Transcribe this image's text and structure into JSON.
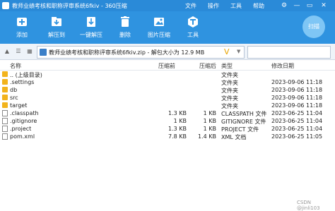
{
  "window": {
    "title": "教师业绩考核和职称评审系统6fkiv - 360压缩",
    "menus": [
      "文件",
      "操作",
      "工具",
      "帮助"
    ],
    "controls": [
      "⚙",
      "—",
      "▭",
      "✕"
    ]
  },
  "toolbar": {
    "items": [
      {
        "label": "添加",
        "icon": "add-icon"
      },
      {
        "label": "解压到",
        "icon": "extract-to-icon"
      },
      {
        "label": "一键解压",
        "icon": "one-click-extract-icon"
      },
      {
        "label": "删除",
        "icon": "delete-icon"
      },
      {
        "label": "图片压缩",
        "icon": "image-compress-icon"
      },
      {
        "label": "工具",
        "icon": "tools-icon"
      }
    ],
    "badge": "扫描"
  },
  "address": {
    "path": "教师业绩考核和职称评审系统6fkiv.zip - 解包大小为 12.9 MB"
  },
  "columns": {
    "name": "名称",
    "size": "压缩前",
    "compressed": "压缩后",
    "type": "类型",
    "modified": "修改日期"
  },
  "files": [
    {
      "name": ".. (上级目录)",
      "size": "",
      "compressed": "",
      "type": "文件夹",
      "modified": "",
      "kind": "folder"
    },
    {
      "name": ".settings",
      "size": "",
      "compressed": "",
      "type": "文件夹",
      "modified": "2023-09-06 11:18",
      "kind": "folder"
    },
    {
      "name": "db",
      "size": "",
      "compressed": "",
      "type": "文件夹",
      "modified": "2023-09-06 11:18",
      "kind": "folder"
    },
    {
      "name": "src",
      "size": "",
      "compressed": "",
      "type": "文件夹",
      "modified": "2023-09-06 11:18",
      "kind": "folder"
    },
    {
      "name": "target",
      "size": "",
      "compressed": "",
      "type": "文件夹",
      "modified": "2023-09-06 11:18",
      "kind": "folder"
    },
    {
      "name": ".classpath",
      "size": "1.3 KB",
      "compressed": "1 KB",
      "type": "CLASSPATH 文件",
      "modified": "2023-06-25 11:04",
      "kind": "file"
    },
    {
      "name": ".gitignore",
      "size": "1 KB",
      "compressed": "1 KB",
      "type": "GITIGNORE 文件",
      "modified": "2023-06-25 11:04",
      "kind": "file"
    },
    {
      "name": ".project",
      "size": "1.3 KB",
      "compressed": "1 KB",
      "type": "PROJECT 文件",
      "modified": "2023-06-25 11:04",
      "kind": "file"
    },
    {
      "name": "pom.xml",
      "size": "7.8 KB",
      "compressed": "1.4 KB",
      "type": "XML 文档",
      "modified": "2023-06-25 11:05",
      "kind": "file"
    }
  ],
  "watermark": "CSDN @jinli103"
}
